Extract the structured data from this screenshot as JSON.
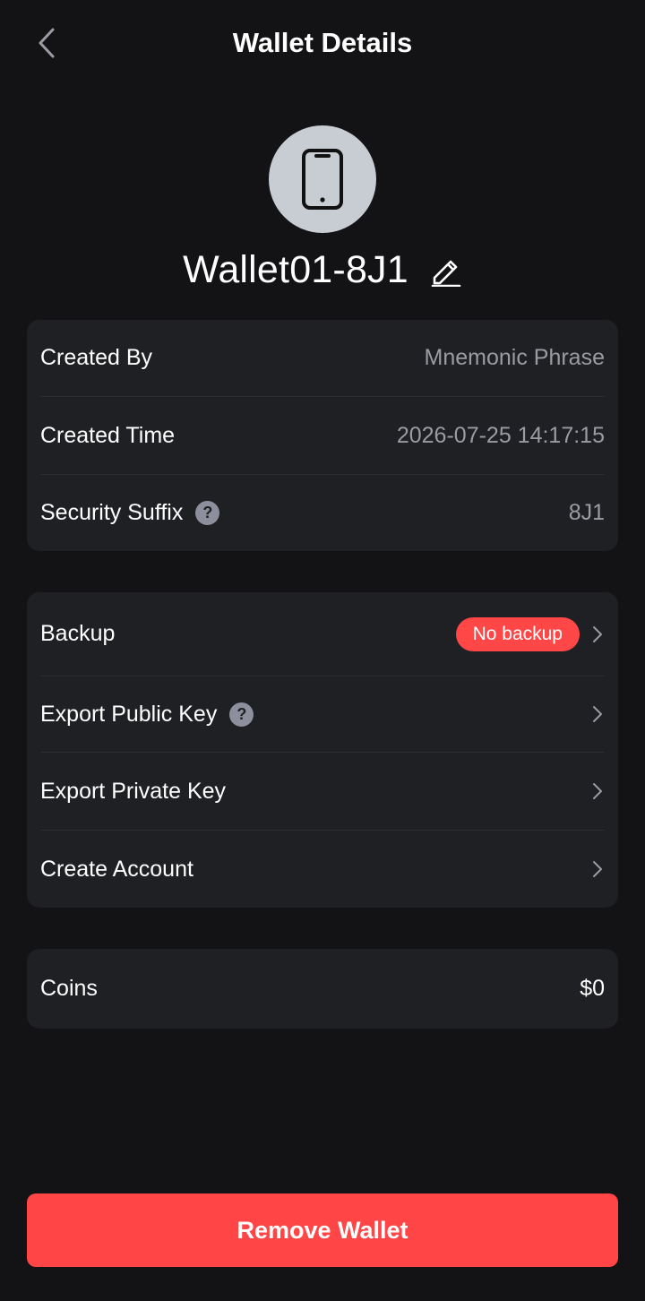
{
  "header": {
    "title": "Wallet Details",
    "back_icon": "chevron-left-icon"
  },
  "wallet": {
    "avatar_icon": "smartphone-icon",
    "name": "Wallet01-8J1",
    "edit_icon": "pencil-icon"
  },
  "info_card": {
    "created_by": {
      "label": "Created By",
      "value": "Mnemonic Phrase"
    },
    "created_time": {
      "label": "Created Time",
      "value": "2026-07-25 14:17:15"
    },
    "security_suffix": {
      "label": "Security Suffix",
      "help": "?",
      "value": "8J1"
    }
  },
  "actions_card": {
    "backup": {
      "label": "Backup",
      "badge": "No backup"
    },
    "export_public_key": {
      "label": "Export Public Key",
      "help": "?"
    },
    "export_private_key": {
      "label": "Export Private Key"
    },
    "create_account": {
      "label": "Create Account"
    }
  },
  "coins_card": {
    "label": "Coins",
    "value": "$0"
  },
  "footer": {
    "remove_label": "Remove Wallet"
  },
  "colors": {
    "background": "#131316",
    "card": "#1f2023",
    "accent_red": "#ff4545",
    "muted_text": "#9a9ba3"
  }
}
